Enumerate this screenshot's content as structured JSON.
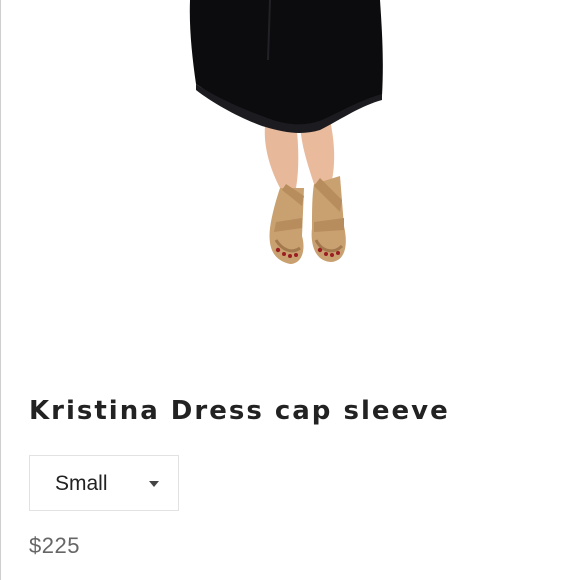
{
  "product": {
    "title": "Kristina Dress cap sleeve",
    "selected_size": "Small",
    "price": "$225"
  }
}
